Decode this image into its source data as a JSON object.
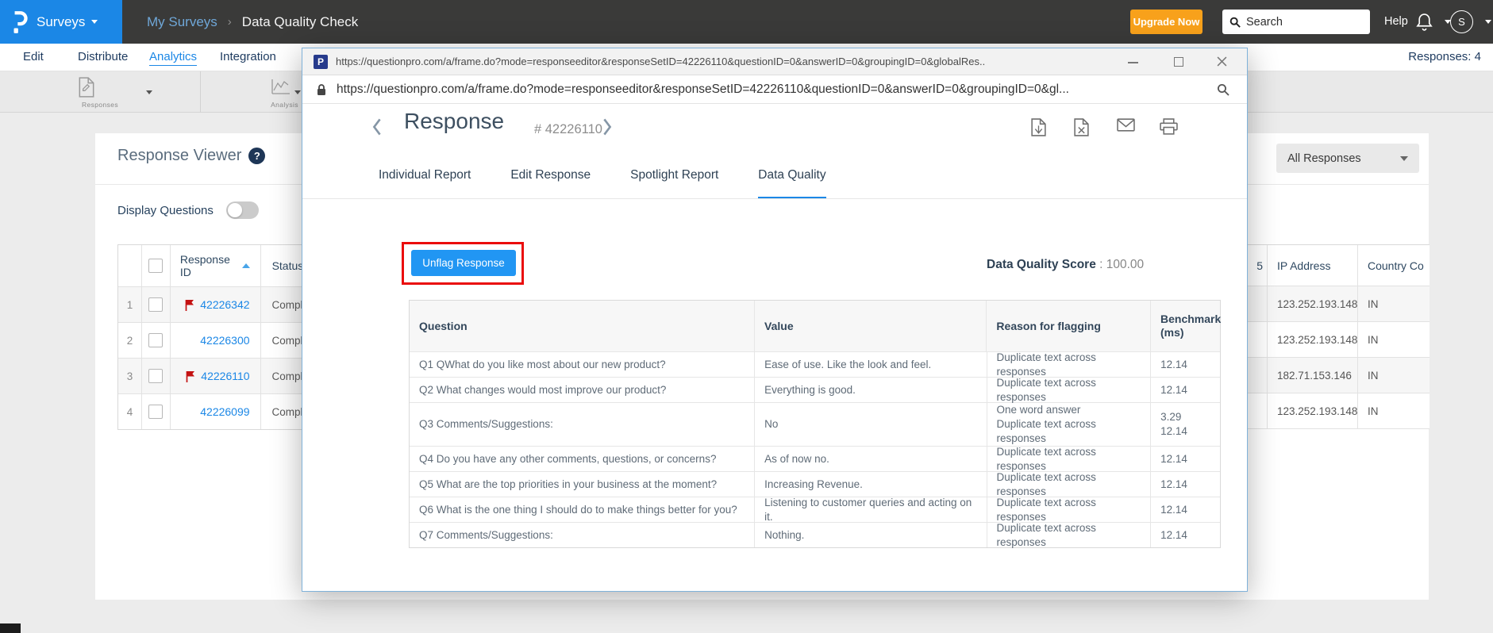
{
  "topbar": {
    "logo_letter": "P",
    "product_menu": "Surveys",
    "breadcrumb": {
      "parent": "My Surveys",
      "separator": "›",
      "current": "Data Quality Check"
    },
    "upgrade_button": "Upgrade Now",
    "search_placeholder": "Search",
    "help_label": "Help",
    "avatar_initial": "S"
  },
  "nav": {
    "items": [
      {
        "label": "Edit"
      },
      {
        "label": "Distribute"
      },
      {
        "label": "Analytics",
        "active": true
      },
      {
        "label": "Integration"
      }
    ],
    "responses_count": "Responses: 4"
  },
  "toolbar": {
    "blocks": [
      {
        "label": "Responses"
      },
      {
        "label": "Analysis"
      }
    ]
  },
  "viewer": {
    "title": "Response Viewer",
    "help_glyph": "?",
    "display_questions_label": "Display Questions",
    "filter_dropdown": "All Responses",
    "table": {
      "headers": {
        "response_id": "Response ID",
        "status": "Status",
        "partial_left": "5",
        "ip": "IP Address",
        "country": "Country Co"
      },
      "rows": [
        {
          "num": "1",
          "flagged": true,
          "id": "42226342",
          "status": "Comple",
          "ip": "123.252.193.148",
          "country": "IN"
        },
        {
          "num": "2",
          "flagged": false,
          "id": "42226300",
          "status": "Comple",
          "ip": "123.252.193.148",
          "country": "IN"
        },
        {
          "num": "3",
          "flagged": true,
          "id": "42226110",
          "status": "Comple",
          "ip": "182.71.153.146",
          "country": "IN"
        },
        {
          "num": "4",
          "flagged": false,
          "id": "42226099",
          "status": "Comple",
          "ip": "123.252.193.148",
          "country": "IN"
        }
      ]
    }
  },
  "modal": {
    "window_title_url": "https://questionpro.com/a/frame.do?mode=responseeditor&responseSetID=42226110&questionID=0&answerID=0&groupingID=0&globalRes..",
    "address_url": "https://questionpro.com/a/frame.do?mode=responseeditor&responseSetID=42226110&questionID=0&answerID=0&groupingID=0&gl...",
    "favicon_letter": "P",
    "header": {
      "title": "Response",
      "response_number": "# 42226110"
    },
    "tabs": [
      {
        "label": "Individual Report"
      },
      {
        "label": "Edit Response"
      },
      {
        "label": "Spotlight Report"
      },
      {
        "label": "Data Quality",
        "active": true
      }
    ],
    "unflag_button": "Unflag Response",
    "score_label": "Data Quality Score",
    "score_value": " : 100.00",
    "table": {
      "headers": [
        "Question",
        "Value",
        "Reason for flagging",
        "Benchmark (ms)"
      ],
      "rows": [
        {
          "question": "Q1 QWhat do you like most about our new product?",
          "value": "Ease of use. Like the look and feel.",
          "reasons": [
            "Duplicate text across responses"
          ],
          "benchmarks": [
            "12.14"
          ]
        },
        {
          "question": "Q2 What changes would most improve our product?",
          "value": "Everything is good.",
          "reasons": [
            "Duplicate text across responses"
          ],
          "benchmarks": [
            "12.14"
          ]
        },
        {
          "question": "Q3 Comments/Suggestions:",
          "value": "No",
          "reasons": [
            "One word answer",
            "Duplicate text across responses"
          ],
          "benchmarks": [
            "3.29",
            "12.14"
          ]
        },
        {
          "question": "Q4 Do you have any other comments, questions, or concerns?",
          "value": "As of now no.",
          "reasons": [
            "Duplicate text across responses"
          ],
          "benchmarks": [
            "12.14"
          ]
        },
        {
          "question": "Q5 What are the top priorities in your business at the moment?",
          "value": "Increasing Revenue.",
          "reasons": [
            "Duplicate text across responses"
          ],
          "benchmarks": [
            "12.14"
          ]
        },
        {
          "question": "Q6 What is the one thing I should do to make things better for you?",
          "value": "Listening to customer queries and acting on it.",
          "reasons": [
            "Duplicate text across responses"
          ],
          "benchmarks": [
            "12.14"
          ]
        },
        {
          "question": "Q7 Comments/Suggestions:",
          "value": "Nothing.",
          "reasons": [
            "Duplicate text across responses"
          ],
          "benchmarks": [
            "12.14"
          ]
        }
      ]
    }
  },
  "colors": {
    "accent_blue": "#1b87e6",
    "orange": "#f8a11b",
    "navy": "#16335c",
    "flag_red": "#c41212",
    "highlight_red": "#ea0c0c",
    "topbar_bg": "#3a3a39"
  }
}
